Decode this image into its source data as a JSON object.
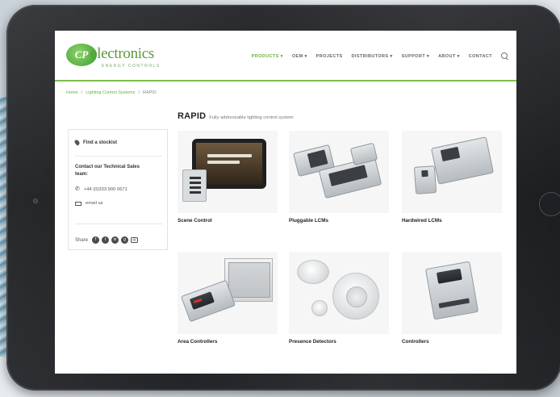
{
  "site": {
    "logo_mark": "CP",
    "logo_word": "electronics",
    "logo_tagline": "ENERGY CONTROLS"
  },
  "nav": {
    "items": [
      {
        "label": "PRODUCTS ▾",
        "active": true
      },
      {
        "label": "OEM ▾",
        "active": false
      },
      {
        "label": "PROJECTS",
        "active": false
      },
      {
        "label": "DISTRIBUTORS ▾",
        "active": false
      },
      {
        "label": "SUPPORT ▾",
        "active": false
      },
      {
        "label": "ABOUT ▾",
        "active": false
      },
      {
        "label": "CONTACT",
        "active": false
      }
    ]
  },
  "breadcrumb": {
    "home": "Home",
    "sep": "/",
    "section": "Lighting Control Systems",
    "current": "RAPID"
  },
  "page": {
    "title": "RAPID",
    "subtitle": "Fully addressable lighting control system"
  },
  "sidebar": {
    "find_stockist": "Find a stockist",
    "contact_heading_1": "Contact our Technical Sales",
    "contact_heading_2": "team:",
    "phone": "+44 (0)333 900 0671",
    "email": "email us",
    "share_label": "Share",
    "share_icons": [
      "f",
      "t",
      "in",
      "g",
      "✉"
    ]
  },
  "products": [
    {
      "label": "Scene Control"
    },
    {
      "label": "Pluggable LCMs"
    },
    {
      "label": "Hardwired LCMs"
    },
    {
      "label": "Area Controllers"
    },
    {
      "label": "Presence Detectors"
    },
    {
      "label": "Controllers"
    }
  ],
  "colors": {
    "brand_green": "#6cae3f",
    "tablet_bezel": "#1f2023"
  }
}
